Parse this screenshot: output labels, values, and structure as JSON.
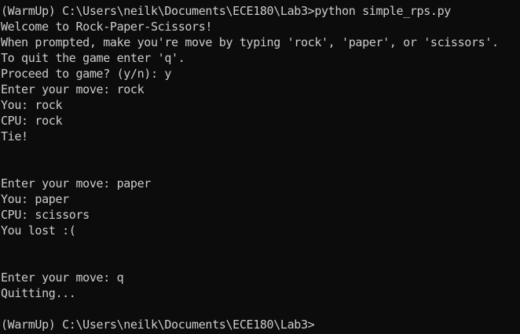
{
  "terminal": {
    "lines": [
      "(WarmUp) C:\\Users\\neilk\\Documents\\ECE180\\Lab3>python simple_rps.py",
      "Welcome to Rock-Paper-Scissors!",
      "When prompted, make you're move by typing 'rock', 'paper', or 'scissors'.",
      "To quit the game enter 'q'.",
      "Proceed to game? (y/n): y",
      "Enter your move: rock",
      "You: rock",
      "CPU: rock",
      "Tie!",
      "",
      "",
      "Enter your move: paper",
      "You: paper",
      "CPU: scissors",
      "You lost :(",
      "",
      "",
      "Enter your move: q",
      "Quitting...",
      "",
      "(WarmUp) C:\\Users\\neilk\\Documents\\ECE180\\Lab3>"
    ]
  }
}
